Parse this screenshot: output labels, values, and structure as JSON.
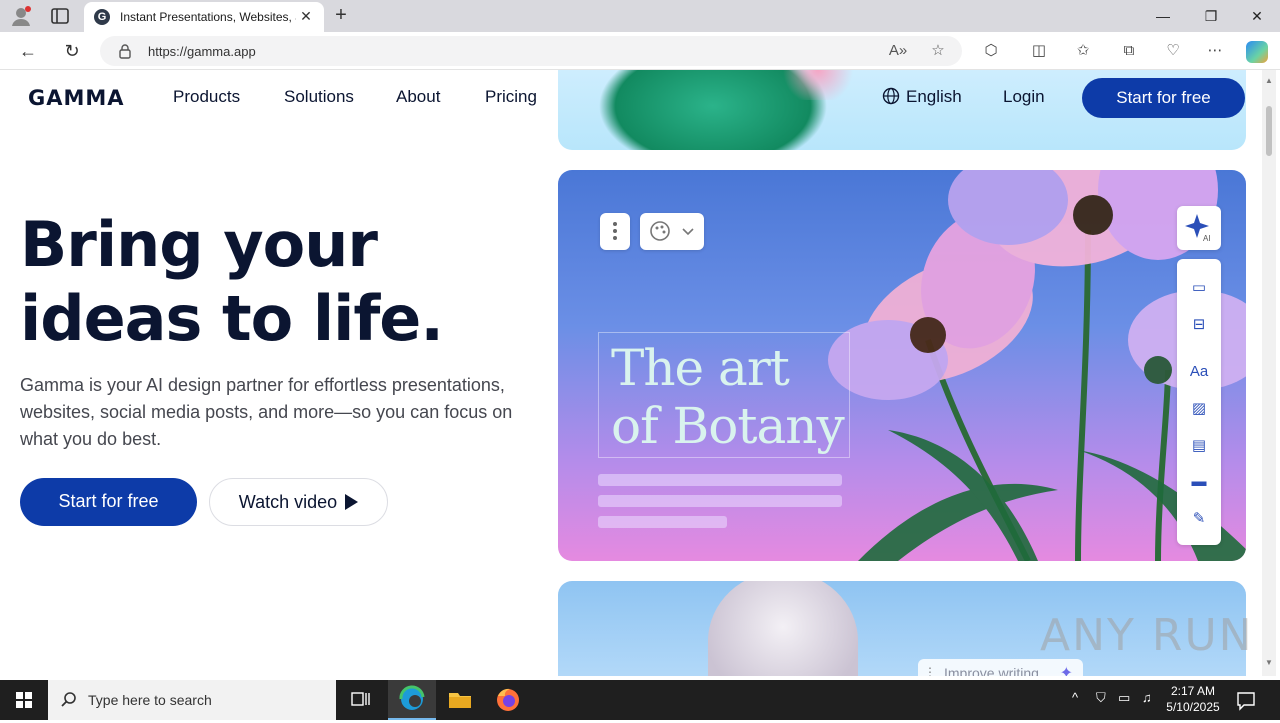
{
  "browser": {
    "tab_title": "Instant Presentations, Websites, a",
    "tab_favicon": "G",
    "url": "https://gamma.app",
    "window_controls": [
      "minimize-icon",
      "restore-icon",
      "close-icon"
    ]
  },
  "page": {
    "logo": "GAMMA",
    "nav": [
      "Products",
      "Solutions",
      "About",
      "Pricing"
    ],
    "language": "English",
    "login": "Login",
    "cta_top": "Start for free",
    "hero_title_line1": "Bring your",
    "hero_title_line2": "ideas to life.",
    "hero_subtitle": "Gamma is your AI design partner for effortless presentations, websites, social media posts, and more—so you can focus on what you do best.",
    "cta_primary": "Start for free",
    "cta_secondary": "Watch video",
    "card_title_line1": "The art",
    "card_title_line2": "of Botany",
    "ai_badge": "AI",
    "improve_writing": "Improve writing",
    "accent_color": "#0d3ba8"
  },
  "taskbar": {
    "search_placeholder": "Type here to search",
    "time": "2:17 AM",
    "date": "5/10/2025"
  },
  "watermark": "ANY RUN"
}
